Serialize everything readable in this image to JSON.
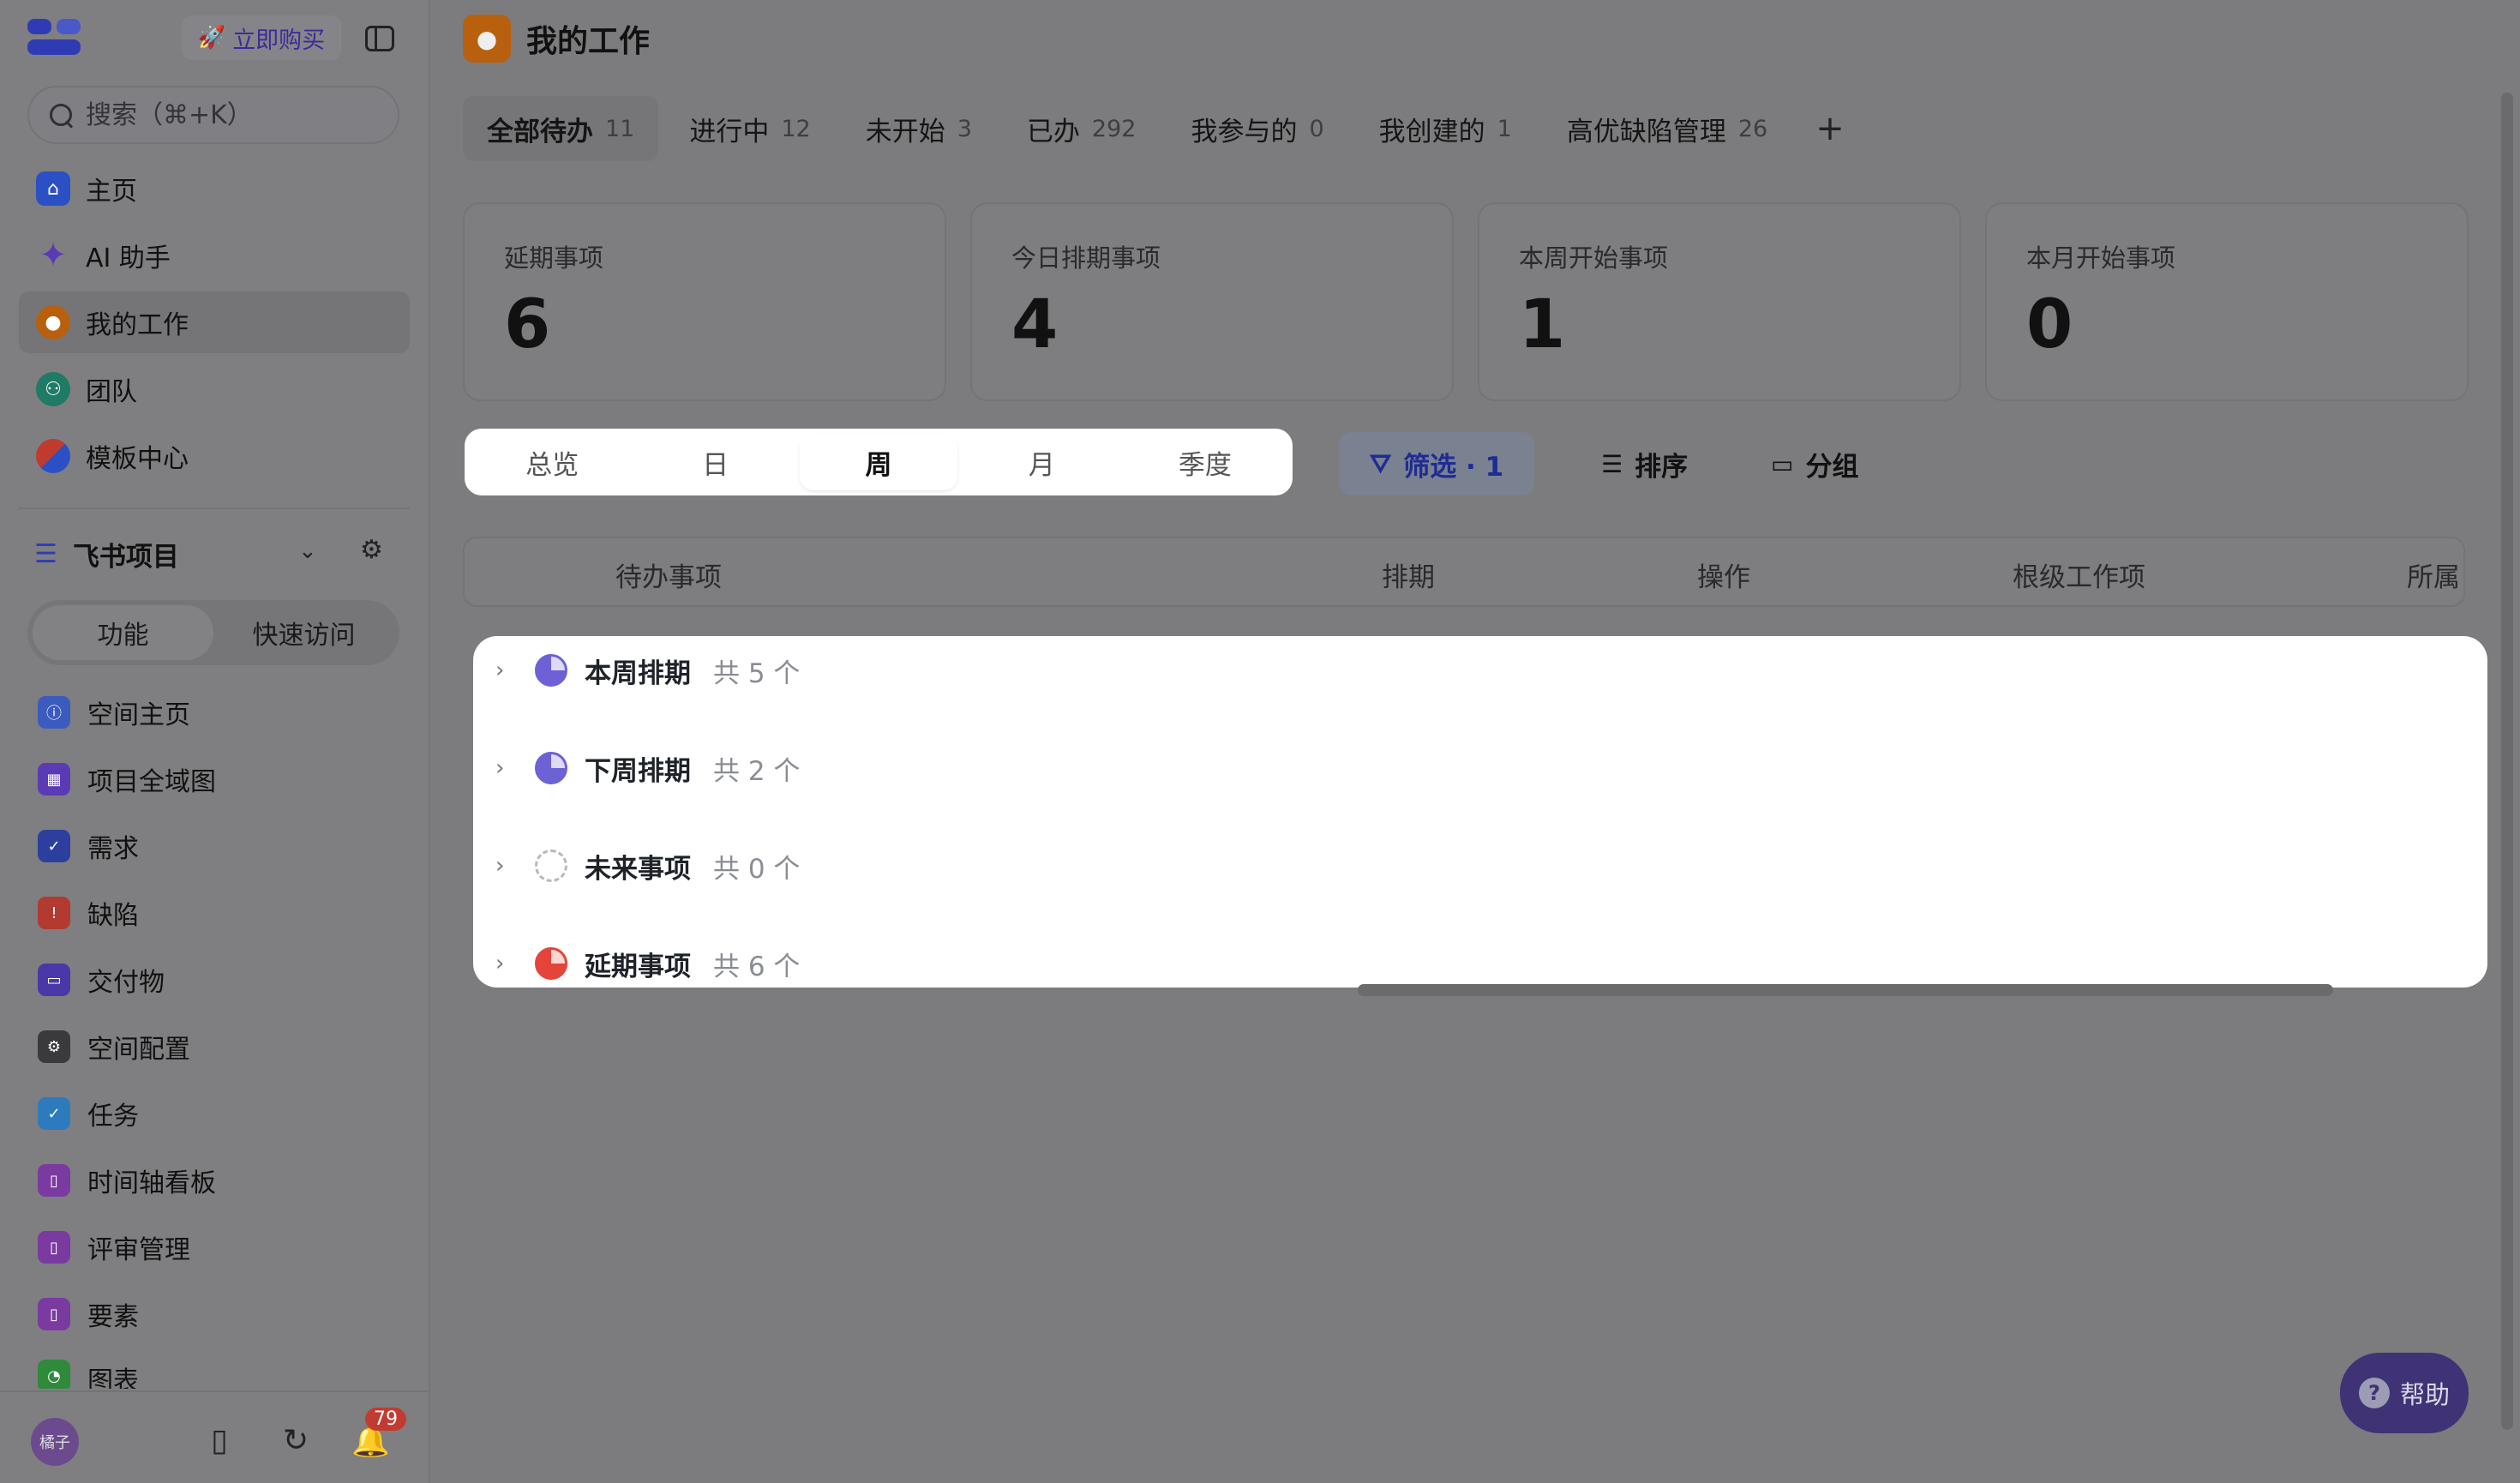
{
  "sidebar": {
    "buy_label": "立即购买",
    "search_placeholder": "搜索（⌘+K）",
    "nav": [
      {
        "label": "主页",
        "icon": "home-icon",
        "color": "#2b4fc4"
      },
      {
        "label": "AI 助手",
        "icon": "sparkle-icon",
        "color": "#5a3bb5"
      },
      {
        "label": "我的工作",
        "icon": "person-icon",
        "color": "#b8600e",
        "active": true
      },
      {
        "label": "团队",
        "icon": "team-icon",
        "color": "#1f7a66"
      },
      {
        "label": "模板中心",
        "icon": "template-icon",
        "color": "#c03a2e"
      }
    ],
    "project": {
      "label": "飞书项目"
    },
    "segment": [
      "功能",
      "快速访问"
    ],
    "features": [
      {
        "label": "空间主页",
        "icon": "info-icon",
        "color": "#3b5bbf"
      },
      {
        "label": "项目全域图",
        "icon": "grid-icon",
        "color": "#5b3bb5"
      },
      {
        "label": "需求",
        "icon": "check-circle-icon",
        "color": "#2d3f9e"
      },
      {
        "label": "缺陷",
        "icon": "alert-icon",
        "color": "#b23a30"
      },
      {
        "label": "交付物",
        "icon": "folder-icon",
        "color": "#4a38a8"
      },
      {
        "label": "空间配置",
        "icon": "gear-icon",
        "color": "#3a3a3e"
      },
      {
        "label": "任务",
        "icon": "task-icon",
        "color": "#2d7bbd"
      },
      {
        "label": "时间轴看板",
        "icon": "bookmark-icon",
        "color": "#7a3aa0"
      },
      {
        "label": "评审管理",
        "icon": "bookmark-icon",
        "color": "#7a3aa0"
      },
      {
        "label": "要素",
        "icon": "bookmark-icon",
        "color": "#7a3aa0"
      },
      {
        "label": "图表",
        "icon": "chart-icon",
        "color": "#2f8a3c"
      }
    ],
    "footer": {
      "avatar_text": "橘子",
      "notification_count": "79"
    }
  },
  "main": {
    "title": "我的工作",
    "tabs": [
      {
        "label": "全部待办",
        "count": "11",
        "active": true
      },
      {
        "label": "进行中",
        "count": "12"
      },
      {
        "label": "未开始",
        "count": "3"
      },
      {
        "label": "已办",
        "count": "292"
      },
      {
        "label": "我参与的",
        "count": "0"
      },
      {
        "label": "我创建的",
        "count": "1"
      },
      {
        "label": "高优缺陷管理",
        "count": "26"
      }
    ],
    "add_tab": "+",
    "cards": [
      {
        "label": "延期事项",
        "value": "6"
      },
      {
        "label": "今日排期事项",
        "value": "4"
      },
      {
        "label": "本周开始事项",
        "value": "1"
      },
      {
        "label": "本月开始事项",
        "value": "0"
      }
    ],
    "views": [
      "总览",
      "日",
      "周",
      "月",
      "季度"
    ],
    "active_view": "周",
    "toolbar": {
      "filter": "筛选 · 1",
      "sort": "排序",
      "group": "分组"
    },
    "columns": [
      "待办事项",
      "排期",
      "操作",
      "根级工作项",
      "所属"
    ],
    "groups": [
      {
        "name": "本周排期",
        "count": "共 5 个",
        "icon_color": "#6c62d6",
        "style": "pie"
      },
      {
        "name": "下周排期",
        "count": "共 2 个",
        "icon_color": "#6c62d6",
        "style": "pie"
      },
      {
        "name": "未来事项",
        "count": "共 0 个",
        "icon_color": "#b8b8bc",
        "style": "dashed"
      },
      {
        "name": "延期事项",
        "count": "共 6 个",
        "icon_color": "#e5443a",
        "style": "pie"
      }
    ],
    "help_label": "帮助"
  }
}
